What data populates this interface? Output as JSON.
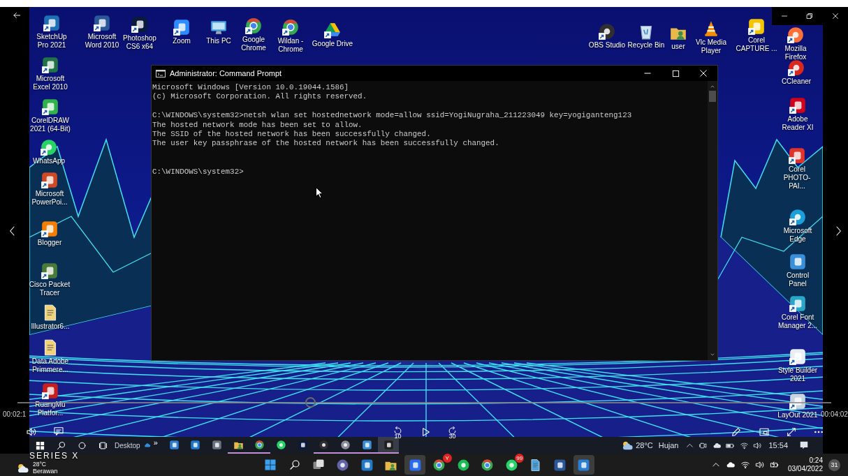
{
  "player": {
    "elapsed": "00:02:1",
    "total": "00:04:02",
    "seek": {
      "level": 0.36
    },
    "replay_seconds": "10",
    "forward_seconds": "30"
  },
  "desktop_icons": [
    {
      "label": "SketchUp Pro 2021",
      "kind": "sketchup",
      "shortcut": true
    },
    {
      "label": "Microsoft Word 2010",
      "kind": "word",
      "shortcut": true
    },
    {
      "label": "Photoshop CS6 x64",
      "kind": "photoshop",
      "shortcut": true
    },
    {
      "label": "Zoom",
      "kind": "zoom",
      "shortcut": true
    },
    {
      "label": "This PC",
      "kind": "pc",
      "shortcut": false
    },
    {
      "label": "Google Chrome",
      "kind": "chrome",
      "shortcut": true
    },
    {
      "label": "Wildan - Chrome",
      "kind": "chrome",
      "shortcut": true
    },
    {
      "label": "Google Drive",
      "kind": "drive",
      "shortcut": true
    },
    {
      "label": "OBS Studio",
      "kind": "obs",
      "shortcut": true
    },
    {
      "label": "Recycle Bin",
      "kind": "recycle",
      "shortcut": false
    },
    {
      "label": "user",
      "kind": "folder",
      "shortcut": false
    },
    {
      "label": "Vlc Media Player",
      "kind": "vlc",
      "shortcut": false
    },
    {
      "label": "Corel CAPTURE ...",
      "kind": "capture",
      "shortcut": true
    },
    {
      "label": "Mozilla Firefox",
      "kind": "firefox",
      "shortcut": true
    },
    {
      "label": "Microsoft Excel 2010",
      "kind": "excel",
      "shortcut": true
    },
    {
      "label": "CorelDRAW 2021 (64-Bit)",
      "kind": "coreldraw",
      "shortcut": true
    },
    {
      "label": "WhatsApp",
      "kind": "whatsapp",
      "shortcut": true
    },
    {
      "label": "Microsoft PowerPoi...",
      "kind": "powerpoint",
      "shortcut": true
    },
    {
      "label": "Blogger",
      "kind": "blogger",
      "shortcut": true
    },
    {
      "label": "Cisco Packet Tracer",
      "kind": "cisco",
      "shortcut": true
    },
    {
      "label": "Illustrator6...",
      "kind": "file",
      "shortcut": false
    },
    {
      "label": "Data Adobe Primmere...",
      "kind": "file",
      "shortcut": false
    },
    {
      "label": "RuangMu Platfor...",
      "kind": "ruangmu",
      "shortcut": true
    },
    {
      "label": "CCleaner",
      "kind": "ccleaner",
      "shortcut": true
    },
    {
      "label": "Adobe Reader XI",
      "kind": "pdf",
      "shortcut": true
    },
    {
      "label": "Corel PHOTO-PAI...",
      "kind": "photopaint",
      "shortcut": true
    },
    {
      "label": "Microsoft Edge",
      "kind": "edge",
      "shortcut": true
    },
    {
      "label": "Control Panel",
      "kind": "control",
      "shortcut": false
    },
    {
      "label": "Corel Font Manager 2...",
      "kind": "font",
      "shortcut": true
    },
    {
      "label": "Style Builder 2021",
      "kind": "stylebuilder",
      "shortcut": true
    },
    {
      "label": "LayOut 2021",
      "kind": "layout",
      "shortcut": true
    }
  ],
  "cmd": {
    "title": "Administrator: Command Prompt",
    "blocks": [
      [
        "Microsoft Windows [Version 10.0.19044.1586]",
        "(c) Microsoft Corporation. All rights reserved."
      ],
      [
        "C:\\WINDOWS\\system32>netsh wlan set hostednetwork mode=allow ssid=YogiNugraha_211223049 key=yogiganteng123",
        "The hosted network mode has been set to allow.",
        "The SSID of the hosted network has been successfully changed.",
        "The user key passphrase of the hosted network has been successfully changed."
      ],
      [
        "C:\\WINDOWS\\system32>"
      ]
    ]
  },
  "inner_taskbar": {
    "toolbar_label": "Desktop",
    "overflow": "»",
    "apps": [
      {
        "kind": "store",
        "running": false,
        "active": false
      },
      {
        "kind": "mail",
        "running": false,
        "active": false
      },
      {
        "kind": "camera",
        "running": false,
        "active": false
      },
      {
        "kind": "folder",
        "running": true,
        "active": false
      },
      {
        "kind": "chrome",
        "running": true,
        "active": false
      },
      {
        "kind": "whatsapp",
        "running": false,
        "active": false
      },
      {
        "kind": "photoshop",
        "running": false,
        "active": false
      },
      {
        "kind": "obs",
        "running": true,
        "active": false
      },
      {
        "kind": "settings",
        "running": true,
        "active": false
      },
      {
        "kind": "control",
        "running": true,
        "active": false
      },
      {
        "kind": "cmd",
        "running": true,
        "active": true
      }
    ],
    "temperature": "28°C",
    "condition": "Hujan",
    "time": "15:54"
  },
  "taskbar": {
    "overlay_text": "SERIES X",
    "temperature": "28°C",
    "condition": "Berawan",
    "apps": [
      {
        "kind": "start",
        "active": false
      },
      {
        "kind": "search",
        "active": false
      },
      {
        "kind": "taskview",
        "active": false
      },
      {
        "kind": "teams",
        "active": false
      },
      {
        "kind": "mail",
        "active": false
      },
      {
        "kind": "folder",
        "active": false
      },
      {
        "kind": "editor",
        "active": true
      },
      {
        "kind": "chrome",
        "active": false,
        "badge": "Y"
      },
      {
        "kind": "spotify",
        "active": false
      },
      {
        "kind": "chrome",
        "active": false
      },
      {
        "kind": "whatsapp",
        "active": false,
        "badge": "99"
      },
      {
        "kind": "notepad",
        "active": false
      },
      {
        "kind": "word",
        "active": false
      },
      {
        "kind": "media",
        "active": true
      }
    ],
    "time": "0:24",
    "date": "03/04/2022",
    "notification_count": "31"
  }
}
